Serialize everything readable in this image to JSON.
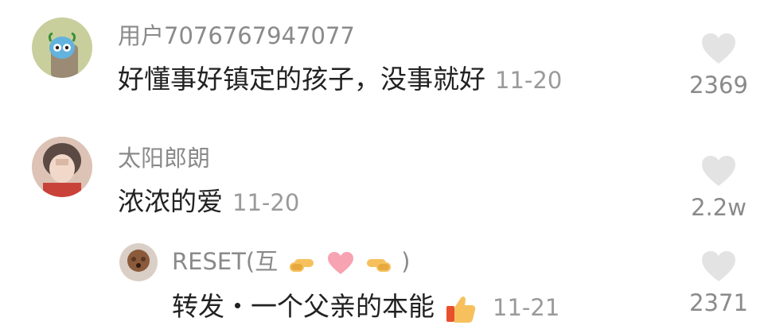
{
  "comments": [
    {
      "username": "用户7076767947077",
      "text": "好懂事好镇定的孩子，没事就好",
      "date": "11-20",
      "likes": "2369"
    },
    {
      "username": "太阳郎朗",
      "text": "浓浓的爱",
      "date": "11-20",
      "likes": "2.2w"
    }
  ],
  "reply": {
    "username_prefix": "RESET(互",
    "username_suffix": ")",
    "username_emojis": [
      "pointing-right-hand-emoji",
      "heart-emoji",
      "pointing-left-hand-emoji"
    ],
    "text": "转发・一个父亲的本能",
    "text_emoji": "thumbs-up-emoji",
    "date": "11-21",
    "likes": "2371"
  },
  "colors": {
    "username": "#8a8a8a",
    "text": "#222222",
    "date": "#9a9a9a",
    "heart": "#e3e3e3"
  },
  "icons": [
    "heart-outline-icon"
  ]
}
